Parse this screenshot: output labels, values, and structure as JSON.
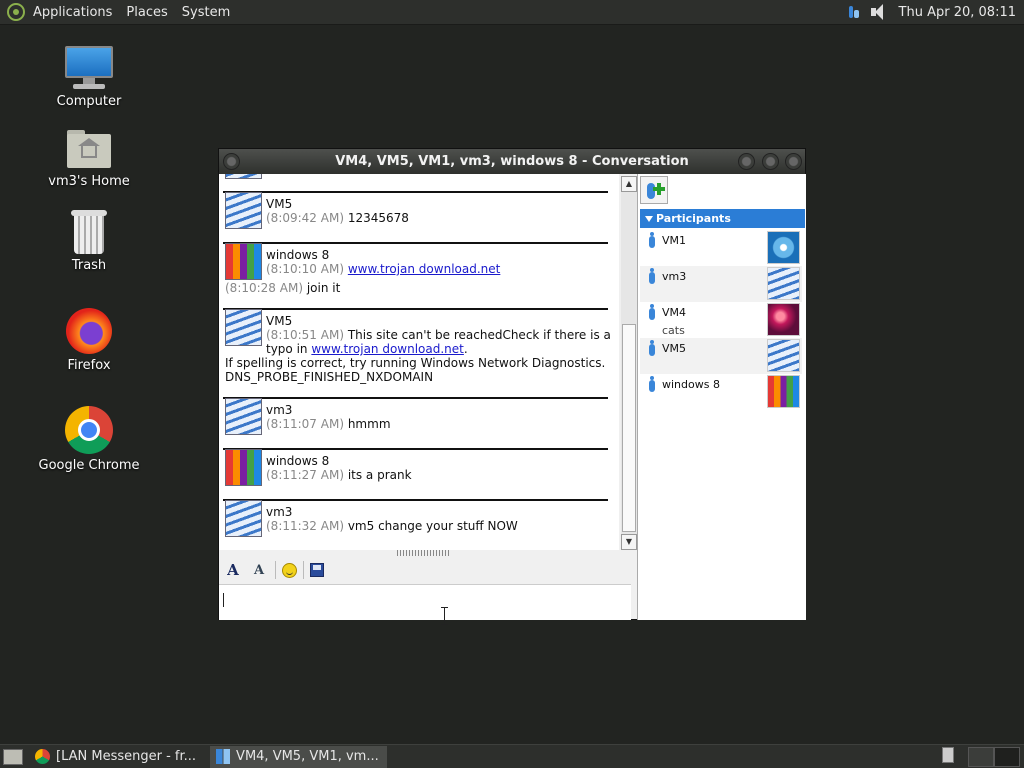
{
  "top_panel": {
    "menus": [
      "Applications",
      "Places",
      "System"
    ],
    "clock": "Thu Apr 20, 08:11"
  },
  "desktop_icons": [
    {
      "label": "Computer"
    },
    {
      "label": "vm3's Home"
    },
    {
      "label": "Trash"
    },
    {
      "label": "Firefox"
    },
    {
      "label": "Google Chrome"
    }
  ],
  "window": {
    "title": "VM4, VM5, VM1, vm3, windows 8 - Conversation"
  },
  "messages": [
    {
      "sender": "VM5",
      "lines": [
        {
          "time": "(8:09:42 AM)",
          "text": "12345678"
        }
      ]
    },
    {
      "sender": "windows 8",
      "lines": [
        {
          "time": "(8:10:10 AM)",
          "link": "www.trojan download.net"
        },
        {
          "time": "(8:10:28 AM)",
          "text": "join it"
        }
      ]
    },
    {
      "sender": "VM5",
      "lines": [
        {
          "time": "(8:10:51 AM)",
          "text": "This site can't be reachedCheck if there is a"
        },
        {
          "text": "typo in",
          "link": "www.trojan download.net",
          "after": "."
        },
        {
          "text": "If spelling is correct, try running Windows Network Diagnostics."
        },
        {
          "text": "DNS_PROBE_FINISHED_NXDOMAIN"
        }
      ]
    },
    {
      "sender": "vm3",
      "lines": [
        {
          "time": "(8:11:07 AM)",
          "text": "hmmm"
        }
      ]
    },
    {
      "sender": "windows 8",
      "lines": [
        {
          "time": "(8:11:27 AM)",
          "text": "its a prank"
        }
      ]
    },
    {
      "sender": "vm3",
      "lines": [
        {
          "time": "(8:11:32 AM)",
          "text": "vm5 change your stuff NOW"
        }
      ]
    }
  ],
  "participants": {
    "header": "Participants",
    "list": [
      {
        "name": "VM1",
        "status": "",
        "avatar": "ferris"
      },
      {
        "name": "vm3",
        "status": "",
        "avatar": "swirl"
      },
      {
        "name": "VM4",
        "status": "cats",
        "avatar": "ball"
      },
      {
        "name": "VM5",
        "status": "",
        "avatar": "swirl"
      },
      {
        "name": "windows 8",
        "status": "",
        "avatar": "crayons"
      }
    ]
  },
  "input": {
    "value": ""
  },
  "taskbar": {
    "items": [
      {
        "label": "[LAN Messenger - fr...",
        "active": false
      },
      {
        "label": "VM4, VM5, VM1, vm...",
        "active": true
      }
    ]
  }
}
